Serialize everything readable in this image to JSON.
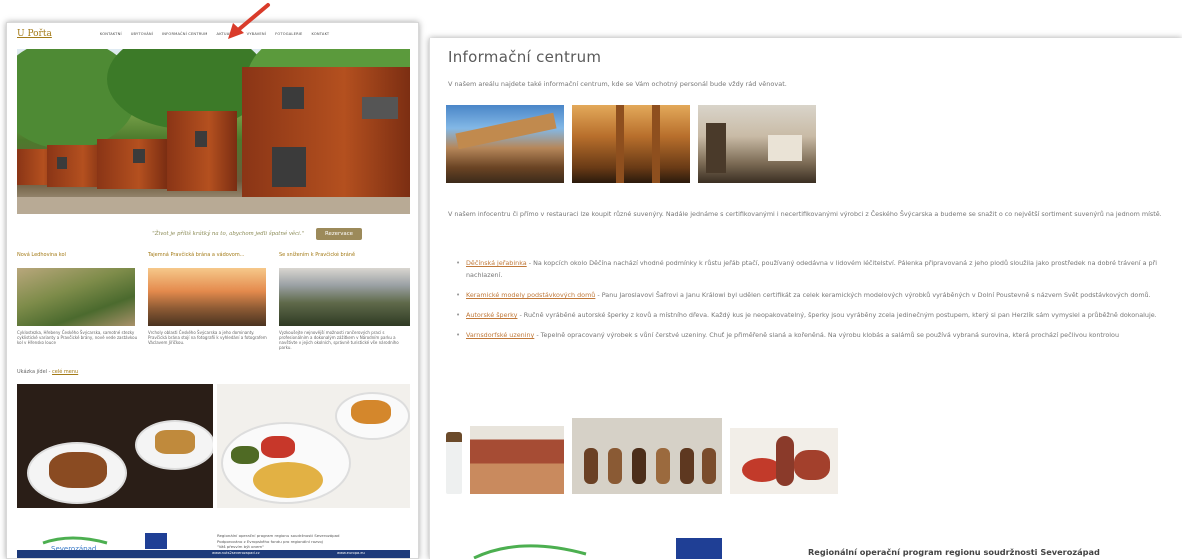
{
  "left": {
    "logo": "U Pořta",
    "menu": [
      "KONTAKTNÍ",
      "UBYTOVÁNÍ",
      "INFORMAČNÍ CENTRUM",
      "AKTUALITY",
      "VYBAVENÍ",
      "FOTOGALERIE",
      "KONTAKT"
    ],
    "quote": "\"Život je příliš krátký na to, abychom jedli špatné věci.\"",
    "reservation": "Rezervace",
    "cols": [
      {
        "title": "Nová Ledhovina kol",
        "text": "Cyklostezka, Hřebeny Českého Švýcarska, samotné stezky cyklistické varianty a Pravčické brány, nově vede zastávkou kol v Hřensko louce"
      },
      {
        "title": "Tajemná Pravčická brána a vádovom...",
        "text": "Vrcholy oblasti Českého Švýcarska a jeho dominanty. Pravčická brána stojí na fotografii k vyhledání a fotografem Václavem Jiřičkou."
      },
      {
        "title": "Se snížením k Pravčické bráně",
        "text": "Vyzkoušejte nejnovější možnosti rančerových prací s profesionálním a dokonalým zážitkem v Národním parku a navštivte v jejich okolních, správně turistické vše národního parku."
      }
    ],
    "dishes": "Ukázka jídel -",
    "dishes_link": "celé menu",
    "footer_text": [
      "Regionální operační program regionu soudržnosti Severozápad",
      "Podporováno z Evropského fondu pro regionální rozvoj",
      "\"Váš přesvím být onem\""
    ],
    "footer_links": [
      "www.nuts2severozapad.cz",
      "www.europa.eu"
    ]
  },
  "right": {
    "title": "Informační centrum",
    "intro": "V našem areálu najdete také informační centrum, kde se Vám ochotný personál bude vždy rád věnovat.",
    "paragraph": "V našem infocentru či přímo v restauraci lze koupit různé suvenýry. Nadále jednáme s certifikovanými i necertifikovanými výrobci z Českého Švýcarska a budeme se snažit o co největší sortiment suvenýrů na jednom místě.",
    "items": [
      {
        "link": "Děčínská jeřabinka",
        "text": " - Na kopcích okolo Děčína nachází vhodné podmínky k růstu jeřáb ptačí, používaný odedávna v lidovém léčitelství. Pálenka připravovaná z jeho plodů sloužila jako prostředek na dobré trávení a při nachlazení."
      },
      {
        "link": "Keramické modely podstávkových domů",
        "text": " - Panu Jaroslavovi Šafrovi a Janu Králowi byl udělen certifikát za celek keramických modelových výrobků vyráběných v Dolní Poustevně s názvem Svět podstávkových domů."
      },
      {
        "link": "Autorské šperky",
        "text": " - Ručně vyráběné autorské šperky z kovů a místního dřeva. Každý kus je neopakovatelný, šperky jsou vyráběny zcela jedinečným postupem, který si pan Herzlík sám vymyslel a průběžně dokonaluje."
      },
      {
        "link": "Varnsdorfské uzeniny",
        "text": " - Tepelně opracovaný výrobek s vůní čerstvé uzeniny. Chuť je přiměřeně slaná a kořeněná. Na výrobu klobás a salámů se používá vybraná surovina, která prochází pečlivou kontrolou"
      }
    ],
    "footer_text": "Regionální operační program regionu soudržnosti Severozápad"
  }
}
